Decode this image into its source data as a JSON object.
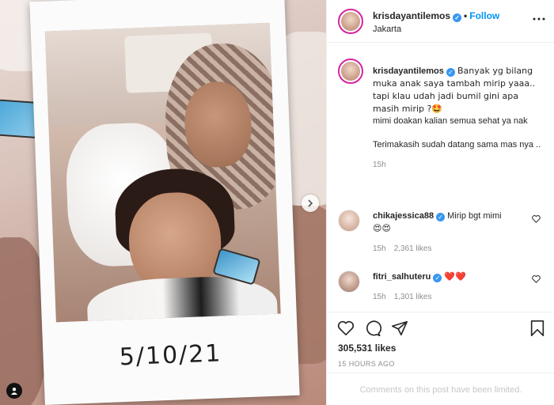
{
  "media": {
    "handwritten_date": "5/10/21",
    "next_icon": "chevron-right-icon",
    "tag_icon": "user-tag-icon"
  },
  "header": {
    "username": "krisdayantilemos",
    "separator": "•",
    "follow_label": "Follow",
    "location": "Jakarta",
    "verified_icon": "verified-badge-icon"
  },
  "caption": {
    "username": "krisdayantilemos",
    "lines": [
      "Banyak yg bilang muka anak saya tambah mirip yaaa.. tapi klau udah jadi bumil gini apa masih mirip ?🤩",
      "mimi doakan kalian semua sehat ya nak",
      "Terimakasih sudah datang sama mas nya .."
    ],
    "time": "15h"
  },
  "comments": [
    {
      "username": "chikajessica88",
      "text": "Mirip bgt mimi",
      "emoji": "😍😍",
      "time": "15h",
      "likes": "2,361 likes"
    },
    {
      "username": "fitri_salhuteru",
      "text": "",
      "emoji": "❤️❤️",
      "time": "15h",
      "likes": "1,301 likes"
    }
  ],
  "actions": {
    "likes": "305,531 likes",
    "time_ago": "15 HOURS AGO",
    "limited_notice": "Comments on this post have been limited."
  },
  "colors": {
    "accent": "#0095f6",
    "verified": "#3897f0",
    "muted": "#8e8e8e"
  }
}
